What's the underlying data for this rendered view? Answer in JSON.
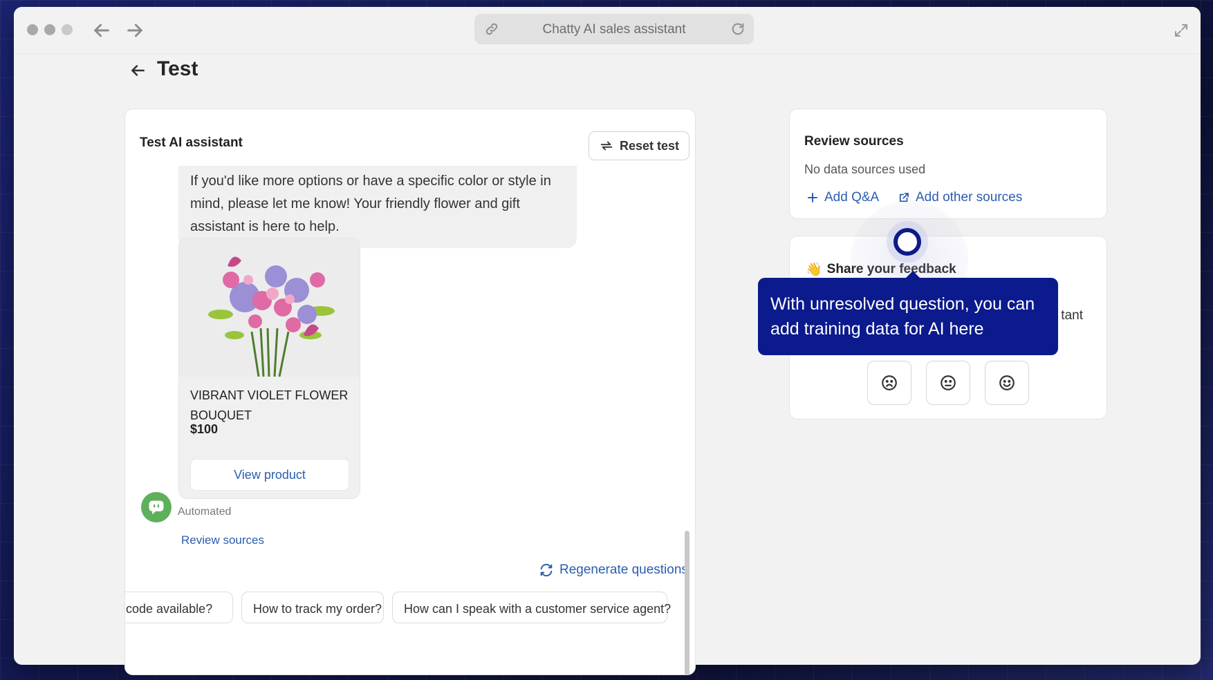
{
  "browser": {
    "url_title": "Chatty AI sales assistant"
  },
  "page": {
    "title": "Test"
  },
  "chat": {
    "header": "Test AI assistant",
    "reset_label": "Reset test",
    "message_text": "If you'd like more options or have a specific color or style in mind, please let me know! Your friendly flower and gift assistant is here to help.",
    "product": {
      "name": "VIBRANT VIOLET FLOWER BOUQUET",
      "price": "$100",
      "button_label": "View product"
    },
    "sender_label": "Automated",
    "review_sources_label": "Review sources",
    "regenerate_label": "Regenerate questions",
    "suggestions": [
      "code available?",
      "How to track my order?",
      "How can I speak with a customer service agent?"
    ]
  },
  "sources": {
    "title": "Review sources",
    "empty_text": "No data sources used",
    "add_qa_label": "Add Q&A",
    "add_other_label": "Add other sources"
  },
  "feedback": {
    "emoji": "👋",
    "title": "Share your feedback",
    "sub_text_visible": "tant"
  },
  "tooltip": {
    "text": "With unresolved question, you can add training data for AI here"
  },
  "colors": {
    "accent_link": "#2a5db0",
    "tooltip_bg": "#0b1a8c",
    "avatar_green": "#5fb05d"
  }
}
